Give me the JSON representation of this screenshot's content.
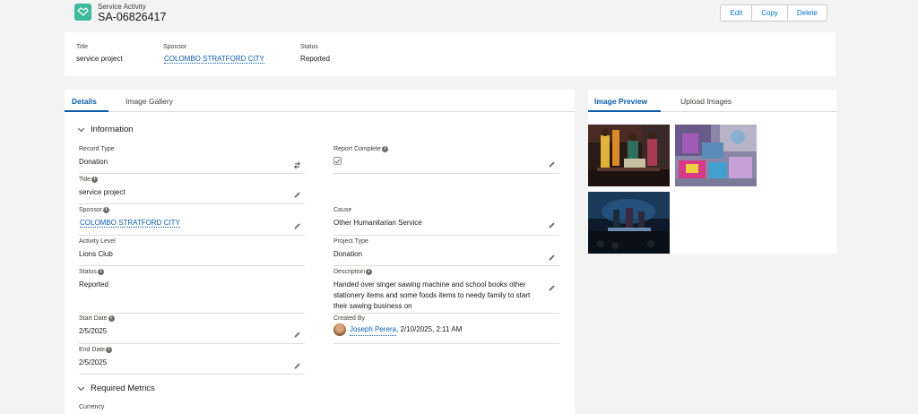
{
  "header": {
    "object_type": "Service Activity",
    "record_name": "SA-06826417",
    "buttons": [
      "Edit",
      "Copy",
      "Delete"
    ]
  },
  "highlights": {
    "title_label": "Title",
    "title_value": "service project",
    "sponsor_label": "Sponsor",
    "sponsor_value": "COLOMBO STRATFORD CITY",
    "status_label": "Status",
    "status_value": "Reported"
  },
  "left_tabs": [
    "Details",
    "Image Gallery"
  ],
  "sections": {
    "information": "Information",
    "required_metrics": "Required Metrics"
  },
  "fields": {
    "record_type": {
      "label": "Record Type",
      "value": "Donation"
    },
    "report_complete": {
      "label": "Report Complete",
      "checked": true
    },
    "title": {
      "label": "Title",
      "value": "service project"
    },
    "sponsor": {
      "label": "Sponsor",
      "value": "COLOMBO STRATFORD CITY"
    },
    "cause": {
      "label": "Cause",
      "value": "Other Humanitarian Service"
    },
    "activity_level": {
      "label": "Activity Level",
      "value": "Lions Club"
    },
    "project_type": {
      "label": "Project Type",
      "value": "Donation"
    },
    "status": {
      "label": "Status",
      "value": "Reported"
    },
    "description": {
      "label": "Description",
      "value": "Handed over singer sawing machine and school books other stationery items and some foods items to needy family to start their sawing business on"
    },
    "start_date": {
      "label": "Start Date",
      "value": "2/5/2025"
    },
    "created_by": {
      "label": "Created By",
      "user": "Joseph Perera",
      "datetime": ", 2/10/2025, 2:11 AM"
    },
    "end_date": {
      "label": "End Date",
      "value": "2/5/2025"
    },
    "currency": {
      "label": "Currency"
    }
  },
  "right_tabs": [
    "Image Preview",
    "Upload Images"
  ],
  "colors": {
    "brand": "#0b5cab",
    "object_icon": "#3bba9c"
  }
}
